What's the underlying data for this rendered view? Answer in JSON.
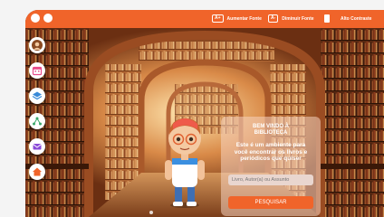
{
  "topbar": {
    "increase_font_badge": "A+",
    "increase_font_label": "Aumentar Fonte",
    "decrease_font_badge": "A-",
    "decrease_font_label": "Diminuir Fonte",
    "contrast_label": "Alto Contraste"
  },
  "sidebar": {
    "items": [
      {
        "icon": "avatar-icon"
      },
      {
        "icon": "calendar-icon"
      },
      {
        "icon": "layers-icon"
      },
      {
        "icon": "network-icon"
      },
      {
        "icon": "mail-icon"
      },
      {
        "icon": "home-icon"
      }
    ]
  },
  "panel": {
    "title_line1": "BEM VINDO À",
    "title_line2": "BIBLIOTECA",
    "description": "Este é um ambiente para você encontrar os livros e periódicos que quiser",
    "search_placeholder": "Livro, Autor(a) ou Assunto",
    "search_button": "PESQUISAR"
  },
  "colors": {
    "accent": "#f0642a",
    "wood": "#8a4a22"
  }
}
